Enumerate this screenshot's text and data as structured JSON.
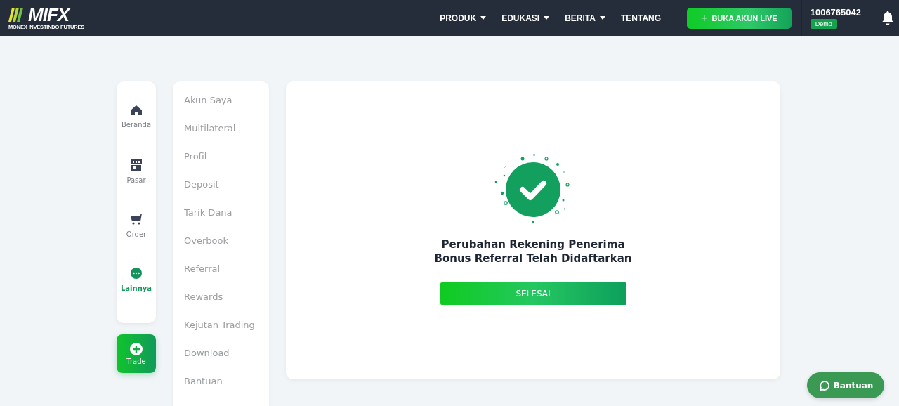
{
  "header": {
    "logo": {
      "wordmark": "MIFX",
      "tagline": "MONEX INVESTINDO FUTURES"
    },
    "nav": [
      {
        "label": "PRODUK",
        "dropdown": true
      },
      {
        "label": "EDUKASI",
        "dropdown": true
      },
      {
        "label": "BERITA",
        "dropdown": true
      },
      {
        "label": "TENTANG",
        "dropdown": false
      }
    ],
    "cta": {
      "icon": "+",
      "label": "BUKA AKUN LIVE"
    },
    "account": {
      "number": "1006765042",
      "badge": "Demo"
    }
  },
  "rail": {
    "items": [
      {
        "kind": "home",
        "label": "Beranda",
        "selected": false
      },
      {
        "kind": "market",
        "label": "Pasar",
        "selected": false
      },
      {
        "kind": "cart",
        "label": "Order",
        "selected": false
      },
      {
        "kind": "more",
        "label": "Lainnya",
        "selected": true
      }
    ],
    "trade_button": {
      "label": "Trade"
    }
  },
  "menu": {
    "items": [
      {
        "label": "Akun Saya"
      },
      {
        "label": "Multilateral"
      },
      {
        "label": "Profil"
      },
      {
        "label": "Deposit"
      },
      {
        "label": "Tarik Dana"
      },
      {
        "label": "Overbook"
      },
      {
        "label": "Referral"
      },
      {
        "label": "Rewards"
      },
      {
        "label": "Kejutan Trading"
      },
      {
        "label": "Download"
      },
      {
        "label": "Bantuan"
      }
    ]
  },
  "success": {
    "message_lines": [
      "Perubahan Rekening Penerima",
      "Bonus Referral Telah Didaftarkan"
    ],
    "button": "SELESAI"
  },
  "help_button": {
    "label": "Bantuan"
  }
}
